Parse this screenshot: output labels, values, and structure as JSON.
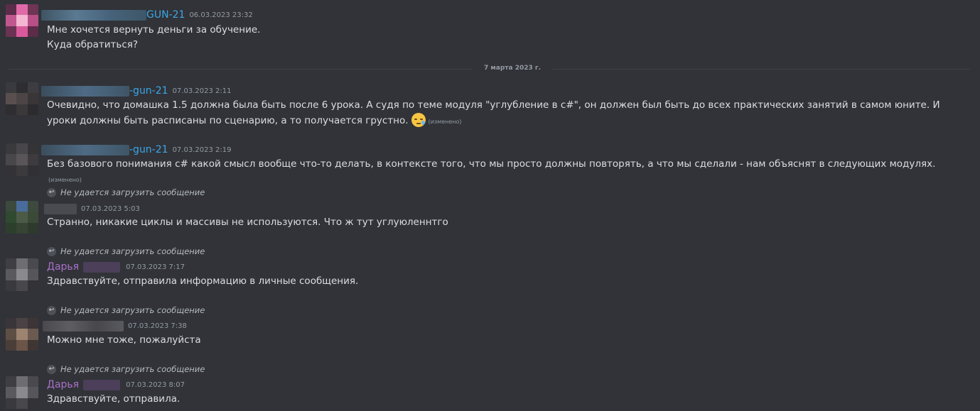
{
  "colors": {
    "background": "#313338",
    "text": "#dbdee1",
    "muted": "#949ba4",
    "link_name": "#3ba7e8",
    "role_name": "#a970c9"
  },
  "messages": [
    {
      "author": "GUN-21",
      "timestamp": "06.03.2023 23:32",
      "lines": [
        "Мне хочется вернуть деньги за обучение.",
        "Куда обратиться?"
      ]
    },
    {
      "author": "-gun-21",
      "timestamp": "07.03.2023 2:11",
      "text": "Очевидно, что домашка 1.5 должна была быть после 6 урока. А судя по теме модуля \"углубление в с#\", он должен был быть до всех практических занятий в самом юните. И уроки должны быть расписаны по сценарию, а то получается грустно.",
      "emoji": "sad-sweat-emoji",
      "edited": "(изменено)"
    },
    {
      "author": "-gun-21",
      "timestamp": "07.03.2023 2:19",
      "text": "Без базового понимания с# какой смысл вообще что-то делать, в контексте того, что мы просто должны повторять, а что мы сделали -  нам объяснят в следующих модулях.",
      "edited": "(изменено)"
    },
    {
      "reply": "Не удается загрузить сообщение",
      "timestamp": "07.03.2023 5:03",
      "text": "Странно, никакие циклы и массивы не используются. Что ж тут углуюленнтго"
    },
    {
      "reply": "Не удается загрузить сообщение",
      "author": "Дарья",
      "timestamp": "07.03.2023 7:17",
      "text": "Здравствуйте, отправила информацию в личные сообщения."
    },
    {
      "reply": "Не удается загрузить сообщение",
      "timestamp": "07.03.2023 7:38",
      "text": "Можно мне тоже, пожалуйста"
    },
    {
      "reply": "Не удается загрузить сообщение",
      "author": "Дарья",
      "timestamp": "07.03.2023 8:07",
      "text": "Здравствуйте, отправила."
    }
  ],
  "date_divider": "7 марта 2023 г."
}
